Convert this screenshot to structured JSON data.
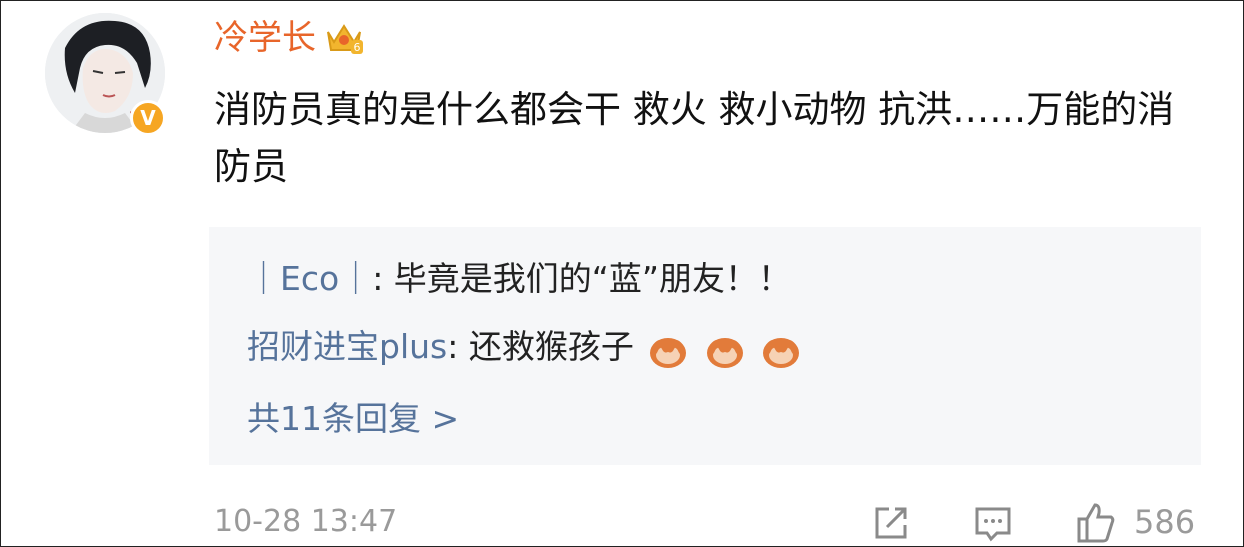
{
  "comment": {
    "username": "冷学长",
    "text": "消防员真的是什么都会干 救火 救小动物 抗洪……万能的消防员",
    "timestamp": "10-28 13:47",
    "like_count": "586",
    "verified_badge": "V",
    "crown_level": "6"
  },
  "replies": [
    {
      "name": "｜Eco｜",
      "text": ": 毕竟是我们的“蓝”朋友！！"
    },
    {
      "name": "招财进宝plus",
      "text": ": 还救猴孩子",
      "emoji_count": 3,
      "emoji_icon": "see-no-evil-monkey-icon"
    },
    {
      "more_text": "共11条回复 >"
    }
  ],
  "icons": {
    "share": "share-icon",
    "comment": "comment-icon",
    "like": "thumbs-up-icon"
  },
  "colors": {
    "username": "#e8652a",
    "reply_name": "#56739b",
    "reply_bg": "#f6f7f9",
    "meta_gray": "#9a9a9a",
    "badge_orange": "#f6a623"
  }
}
